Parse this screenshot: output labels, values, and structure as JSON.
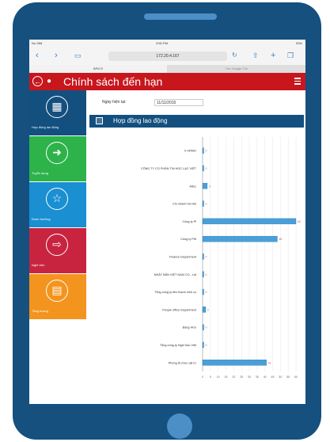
{
  "browser": {
    "status_left": "No SIM",
    "time": "3:50 PM",
    "battery": "53%",
    "url": "172.20.4.167",
    "tabs": [
      "BPICS",
      "Tìm Google Tìm"
    ]
  },
  "app": {
    "title": "Chính sách đến hạn"
  },
  "sidebar": {
    "items": [
      {
        "label": "Hợp đồng lao động",
        "icon": "contract-icon",
        "color": "#13507f"
      },
      {
        "label": "Tuyển dụng",
        "icon": "signin-icon",
        "color": "#2db34a"
      },
      {
        "label": "Khen thưởng",
        "icon": "star-icon",
        "color": "#1a8fd1"
      },
      {
        "label": "Nghỉ việc",
        "icon": "signout-icon",
        "color": "#c8243f"
      },
      {
        "label": "Tăng lương",
        "icon": "money-icon",
        "color": "#f3941e"
      }
    ]
  },
  "filter": {
    "date_label": "Ngày hiện tại:",
    "date_value": "11/11/2015"
  },
  "section": {
    "title": "Hợp đồng lao động"
  },
  "chart_data": {
    "type": "bar",
    "orientation": "horizontal",
    "categories": [
      "ti ORMO",
      "CÔNG TY CỔ PHẦN TIN HỌC LẠC VIỆT",
      "Attec",
      "Chi nhánh Hà Nội",
      "Công ty Pi",
      "Công ty PM",
      "Finance Department",
      "NHẬT BẢN VIỆT NAM CO., Ltd",
      "Tổng công ty tiền thanh ninh cụ",
      "People office Department",
      "Bảng Hữu",
      "Tổng công ty Ngôi Sao Việt",
      "Phòng đi chức vật tư"
    ],
    "values": [
      0,
      0,
      3,
      0,
      60,
      48,
      0,
      0,
      0,
      2,
      0,
      0,
      41
    ],
    "xlim": [
      0,
      60
    ],
    "colors": {
      "bar": "#4a9fd8",
      "bar_dark": "#2a7fbf",
      "value": "#d9534f"
    }
  }
}
